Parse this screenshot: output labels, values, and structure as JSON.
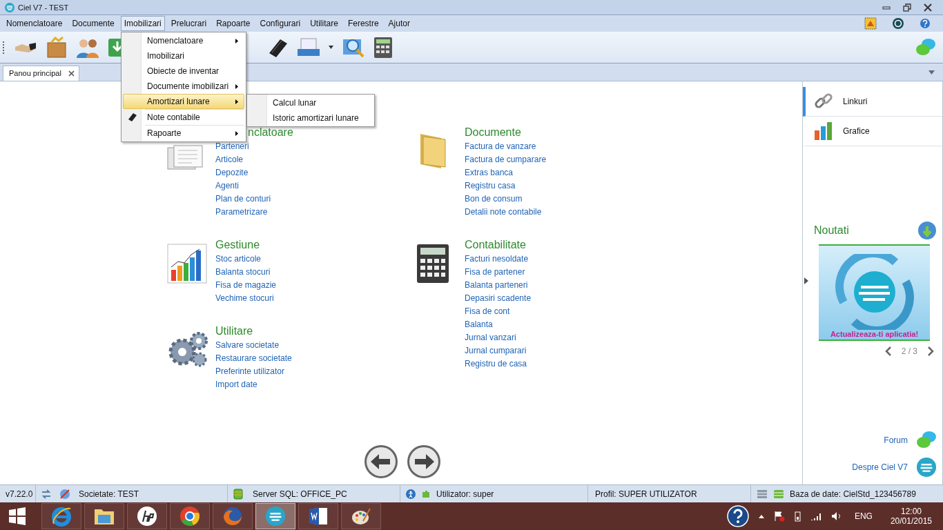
{
  "window": {
    "title": "Ciel V7 - TEST"
  },
  "menu_bar": [
    {
      "label": "Nomenclatoare",
      "selected": false
    },
    {
      "label": "Documente",
      "selected": false
    },
    {
      "label": "Imobilizari",
      "selected": true
    },
    {
      "label": "Prelucrari",
      "selected": false
    },
    {
      "label": "Rapoarte",
      "selected": false
    },
    {
      "label": "Configurari",
      "selected": false
    },
    {
      "label": "Utilitare",
      "selected": false
    },
    {
      "label": "Ferestre",
      "selected": false
    },
    {
      "label": "Ajutor",
      "selected": false
    }
  ],
  "open_menu": {
    "items": [
      {
        "label": "Nomenclatoare",
        "kind": "submenu",
        "selected": false
      },
      {
        "label": "Imobilizari",
        "kind": "command",
        "selected": false
      },
      {
        "label": "Obiecte de inventar",
        "kind": "command",
        "selected": false
      },
      {
        "label": "Documente imobilizari",
        "kind": "submenu",
        "selected": false
      },
      {
        "label": "Amortizari lunare",
        "kind": "submenu",
        "selected": true
      },
      {
        "kind": "separator"
      },
      {
        "label": "Note contabile",
        "kind": "icon_command",
        "selected": false
      },
      {
        "kind": "separator"
      },
      {
        "label": "Rapoarte",
        "kind": "submenu",
        "selected": false
      }
    ]
  },
  "submenu": {
    "items": [
      {
        "label": "Calcul lunar",
        "selected": false
      },
      {
        "label": "Istoric amortizari lunare",
        "selected": false
      }
    ]
  },
  "tabs": [
    {
      "label": "Panou principal",
      "selected": true
    }
  ],
  "columns": [
    [
      {
        "kind": "documents",
        "title": "nclatoare",
        "links": [
          "Parteneri",
          "Articole",
          "Depozite",
          "Agenti",
          "Plan de conturi",
          "Parametrizare"
        ]
      },
      {
        "kind": "chart",
        "title": "Gestiune",
        "links": [
          "Stoc articole",
          "Balanta stocuri",
          "Fisa de magazie",
          "Vechime stocuri"
        ]
      },
      {
        "kind": "gears",
        "title": "Utilitare",
        "links": [
          "Salvare societate",
          "Restaurare societate",
          "Preferinte utilizator",
          "Import date"
        ]
      }
    ],
    [
      {
        "kind": "folder",
        "title": "Documente",
        "links": [
          "Factura de vanzare",
          "Factura de cumparare",
          "Extras banca",
          "Registru casa",
          "Bon de consum",
          "Detalii note contabile"
        ]
      },
      {
        "kind": "calculator",
        "title": "Contabilitate",
        "links": [
          "Facturi nesoldate",
          "Fisa de partener",
          "Balanta parteneri",
          "Depasiri scadente",
          "Fisa de cont",
          "Balanta",
          "Jurnal vanzari",
          "Jurnal cumparari",
          "Registru de casa"
        ]
      }
    ]
  ],
  "side_panel": {
    "items": [
      {
        "label": "Linkuri",
        "kind": "links",
        "selected": true
      },
      {
        "label": "Grafice",
        "kind": "charts",
        "selected": false
      }
    ],
    "news": {
      "title": "Noutati",
      "banner_text": "Actualizeaza-ti aplicatia!",
      "pager": "2 / 3"
    },
    "bottom_links": [
      {
        "label": "Forum",
        "kind": "forum"
      },
      {
        "label": "Despre Ciel V7",
        "kind": "about"
      }
    ]
  },
  "status_bar": {
    "version": "v7.22.0",
    "company": "Societate: TEST",
    "server": "Server SQL: OFFICE_PC",
    "user": "Utilizator: super",
    "profile": "Profil: SUPER UTILIZATOR",
    "database": "Baza de date: CielStd_123456789"
  },
  "taskbar": {
    "apps": [
      {
        "kind": "ie",
        "selected": false
      },
      {
        "kind": "explorer",
        "selected": false
      },
      {
        "kind": "hp",
        "selected": false
      },
      {
        "kind": "chrome",
        "selected": false
      },
      {
        "kind": "firefox",
        "selected": false
      },
      {
        "kind": "ciel",
        "selected": true
      },
      {
        "kind": "word",
        "selected": false
      },
      {
        "kind": "paint",
        "selected": false
      }
    ],
    "language": "ENG",
    "time": "12:00",
    "date": "20/01/2015"
  }
}
